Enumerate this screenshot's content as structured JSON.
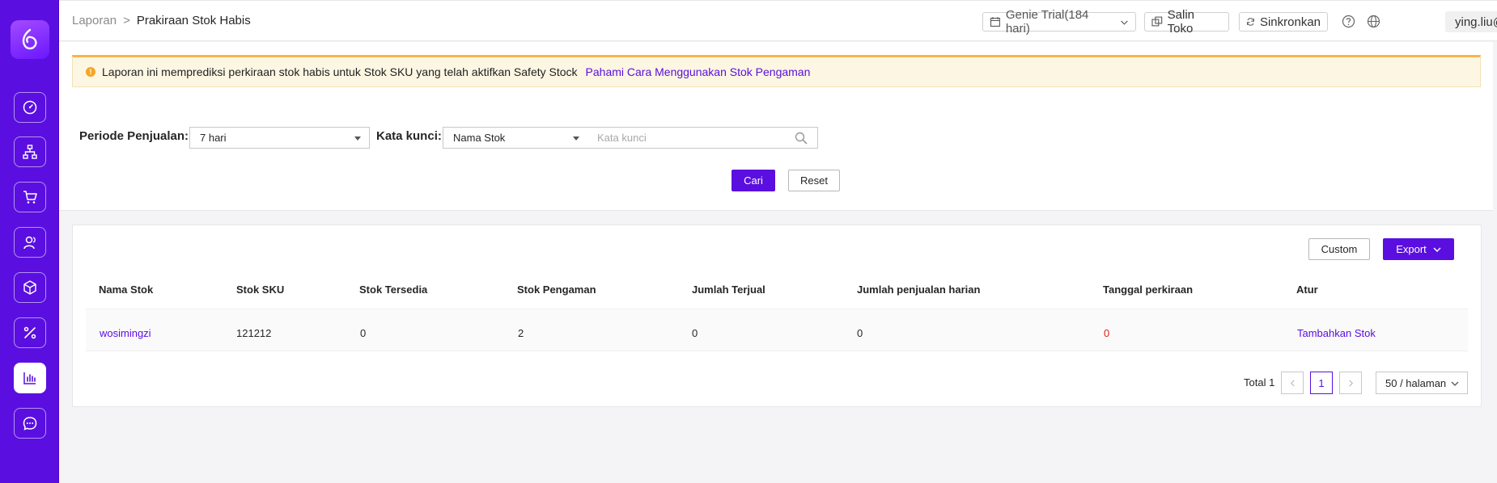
{
  "breadcrumb": {
    "parent": "Laporan",
    "separator": ">",
    "current": "Prakiraan Stok Habis"
  },
  "topbar": {
    "trial": "Genie Trial(184 hari)",
    "copy_store": "Salin Toko",
    "sync": "Sinkronkan",
    "user": "ying.liu@adv..."
  },
  "notice": {
    "text": "Laporan ini memprediksi perkiraan stok habis untuk Stok SKU yang telah aktifkan Safety Stock",
    "link": "Pahami Cara Menggunakan Stok Pengaman"
  },
  "filter": {
    "period_label": "Periode Penjualan:",
    "period_value": "7 hari",
    "keyword_label": "Kata kunci:",
    "keyword_type": "Nama Stok",
    "keyword_placeholder": "Kata kunci",
    "search_btn": "Cari",
    "reset_btn": "Reset"
  },
  "table": {
    "custom_btn": "Custom",
    "export_btn": "Export",
    "columns": [
      "Nama Stok",
      "Stok SKU",
      "Stok Tersedia",
      "Stok Pengaman",
      "Jumlah Terjual",
      "Jumlah penjualan harian",
      "Tanggal perkiraan",
      "Atur"
    ],
    "rows": [
      {
        "name": "wosimingzi",
        "sku": "121212",
        "available": "0",
        "safety": "2",
        "sold": "0",
        "daily": "0",
        "date": "0",
        "action": "Tambahkan Stok"
      }
    ]
  },
  "pagination": {
    "total": "Total 1",
    "current_page": "1",
    "per_page": "50 / halaman"
  },
  "colors": {
    "brand": "#5a0fe0",
    "warning": "#f5a623",
    "danger": "#e02020"
  }
}
